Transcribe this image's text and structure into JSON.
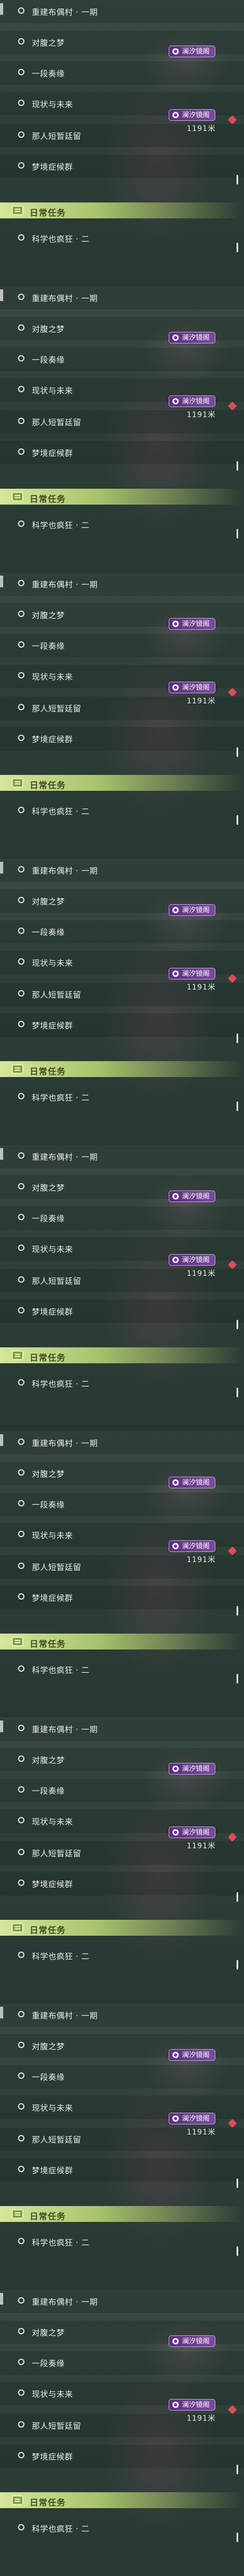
{
  "quest_list": {
    "items": [
      {
        "label": "重建布偶村 · 一期"
      },
      {
        "label": "对腹之梦"
      },
      {
        "label": "一段奏缘"
      },
      {
        "label": "现状与未来"
      },
      {
        "label": "那人短暂廷留"
      },
      {
        "label": "梦境症候群"
      }
    ],
    "tag_label": "澜汐镜阁",
    "distance": "1191米",
    "daily_section_label": "日常任务",
    "daily_item_label": "科学也疯狂 · 二"
  },
  "colors": {
    "tag": "#6a3a8c",
    "section": "#a9c46c",
    "marker": "#e04c56"
  }
}
